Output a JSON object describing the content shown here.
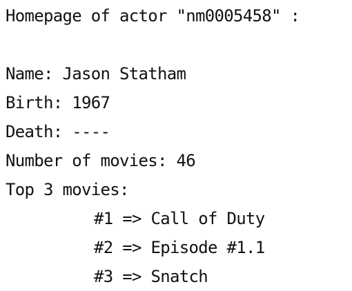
{
  "console": {
    "header": "Homepage of actor \"nm0005458\" :",
    "name_line": "Name: Jason Statham",
    "birth_line": "Birth: 1967",
    "death_line": "Death: ----",
    "movies_count_line": "Number of movies: 46",
    "top_movies_label": "Top 3 movies:",
    "top_movies": [
      "#1 => Call of Duty",
      "#2 => Episode #1.1",
      "#3 => Snatch"
    ]
  }
}
